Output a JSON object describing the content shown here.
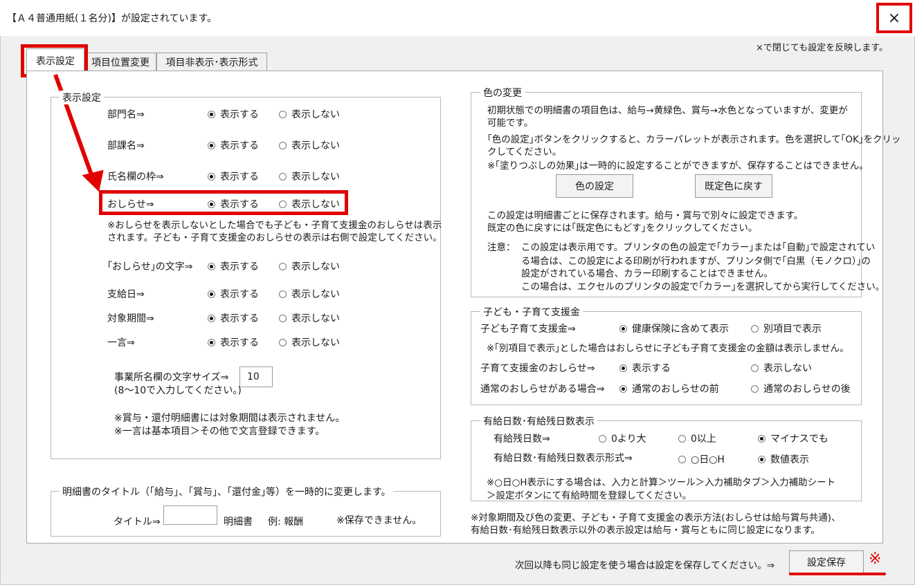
{
  "window": {
    "title": "【Ａ４普通用紙(１名分)】が設定されています。",
    "close_icon": "×",
    "close_note": "×で閉じても設定を反映します。"
  },
  "tabs": [
    "表示設定",
    "項目位置変更",
    "項目非表示･表示形式"
  ],
  "display": {
    "legend": "表示設定",
    "show": "表示する",
    "hide": "表示しない",
    "rows": [
      {
        "label": "部門名⇒",
        "value": "show"
      },
      {
        "label": "部課名⇒",
        "value": "show"
      },
      {
        "label": "氏名欄の枠⇒",
        "value": "show"
      },
      {
        "label": "おしらせ⇒",
        "value": "show"
      },
      {
        "label": "｢おしらせ｣の文字⇒",
        "value": "show"
      },
      {
        "label": "支給日⇒",
        "value": "show"
      },
      {
        "label": "対象期間⇒",
        "value": "show"
      },
      {
        "label": "一言⇒",
        "value": "show"
      }
    ],
    "note_line1": "※おしらせを表示しないとした場合でも子ども・子育て支援金のおしらせは表示",
    "note_line2": "されます。子ども・子育て支援金のおしらせの表示は右側で設定してください。",
    "font_size_label": "事業所名欄の文字サイズ⇒",
    "font_size_hint": "(8～10で入力してください。)",
    "font_size_value": "10",
    "bottom_note1": "※賞与・還付明細書には対象期間は表示されません。",
    "bottom_note2": "※一言は基本項目＞その他で文言登録できます。"
  },
  "title_change": {
    "legend": "明細書のタイトル（｢給与｣、｢賞与｣、｢還付金｣等）を一時的に変更します。",
    "label": "タイトル⇒",
    "value": "",
    "suffix": "明細書",
    "example": "例:  報酬",
    "note": "※保存できません。"
  },
  "color": {
    "legend": "色の変更",
    "desc1": "初期状態での明細書の項目色は、給与→黄緑色、賞与→水色となっていますが、変更が",
    "desc2": "可能です。",
    "desc3": "｢色の設定｣ボタンをクリックすると、カラーパレットが表示されます。色を選択して｢OK｣をクリッ",
    "desc4": "クしてください。",
    "desc5": "※｢塗りつぶしの効果｣は一時的に設定することができますが、保存することはできません。",
    "btn_set": "色の設定",
    "btn_reset": "既定色に戻す",
    "desc6": "この設定は明細書ごとに保存されます。給与・賞与で別々に設定できます。",
    "desc7": "既定の色に戻すには｢既定色にもどす｣をクリックしてください。",
    "caution_label": "注意：",
    "caution1": "この設定は表示用です。プリンタの色の設定で｢カラー｣または｢自動｣で設定されてい",
    "caution2": "る場合は、この設定による印刷が行われますが、プリンタ側で｢白黒（モノクロ）｣の",
    "caution3": "設定がされている場合、カラー印刷することはできません。",
    "caution4": "この場合は、エクセルのプリンタの設定で｢カラー｣を選択してから実行してください。"
  },
  "support": {
    "legend": "子ども・子育て支援金",
    "row1_label": "子ども子育て支援金⇒",
    "row1_opt1": "健康保険に含めて表示",
    "row1_opt2": "別項目で表示",
    "note": "※｢別項目で表示｣とした場合はおしらせに子ども子育て支援金の金額は表示しません。",
    "row2_label": "子育て支援金のおしらせ⇒",
    "row2_opt1": "表示する",
    "row2_opt2": "表示しない",
    "row3_label": "通常のおしらせがある場合⇒",
    "row3_opt1": "通常のおしらせの前",
    "row3_opt2": "通常のおしらせの後"
  },
  "paid_leave": {
    "legend": "有給日数･有給残日数表示",
    "row1_label": "有給残日数⇒",
    "row1_opt1": "0より大",
    "row1_opt2": "0以上",
    "row1_opt3": "マイナスでも",
    "row2_label": "有給日数･有給残日数表示形式⇒",
    "row2_opt1": "○日○H",
    "row2_opt2": "数値表示",
    "note1": "※○日○H表示にする場合は、入力と計算＞ツール＞入力補助タブ＞入力補助シート",
    "note2": "＞設定ボタンにて有給時間を登録してください。"
  },
  "footer_note1": "※対象期間及び色の変更、子ども・子育て支援金の表示方法(おしらせは給与賞与共通)、",
  "footer_note2": "有給日数･有給残日数表示以外の表示設定は給与・賞与ともに同じ設定になります。",
  "save_hint": "次回以降も同じ設定を使う場合は設定を保存してください。⇒",
  "save_button": "設定保存",
  "annotation_mark": "※"
}
